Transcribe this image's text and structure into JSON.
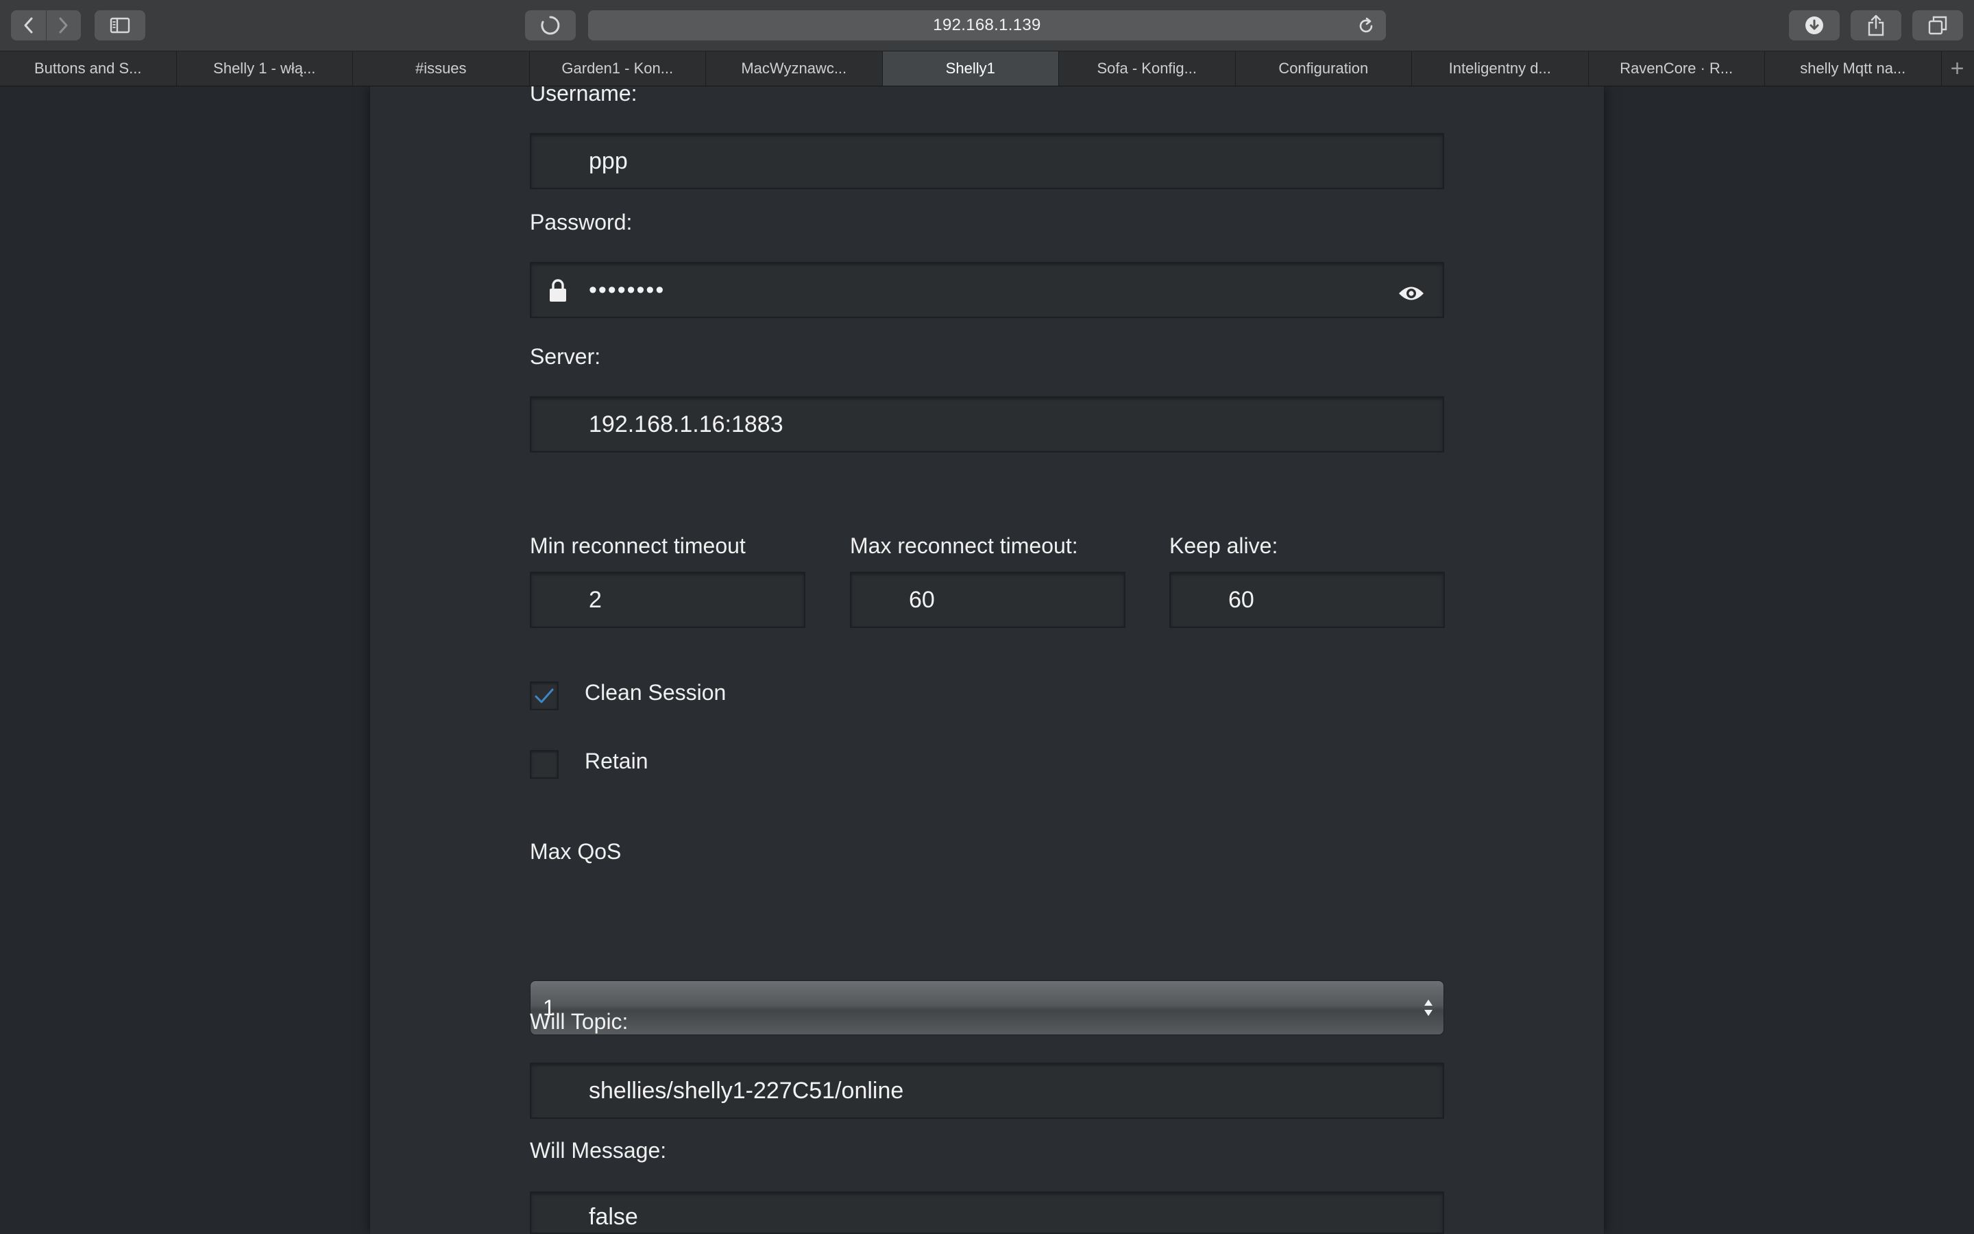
{
  "browser": {
    "url": "192.168.1.139",
    "tabs": [
      {
        "label": "Buttons and S..."
      },
      {
        "label": "Shelly 1 - włą..."
      },
      {
        "label": "#issues"
      },
      {
        "label": "Garden1 - Kon..."
      },
      {
        "label": "MacWyznawc..."
      },
      {
        "label": "Shelly1",
        "active": true
      },
      {
        "label": "Sofa - Konfig..."
      },
      {
        "label": "Configuration"
      },
      {
        "label": "Inteligentny d..."
      },
      {
        "label": "RavenCore · R..."
      },
      {
        "label": "shelly Mqtt na..."
      }
    ],
    "new_tab": "+"
  },
  "form": {
    "username_label": "Username:",
    "username_value": "ppp",
    "password_label": "Password:",
    "password_value": "••••••••",
    "server_label": "Server:",
    "server_value": "192.168.1.16:1883",
    "min_reconnect_label": "Min reconnect timeout",
    "min_reconnect_value": "2",
    "max_reconnect_label": "Max reconnect timeout:",
    "max_reconnect_value": "60",
    "keep_alive_label": "Keep alive:",
    "keep_alive_value": "60",
    "clean_session_label": "Clean Session",
    "clean_session_checked": true,
    "retain_label": "Retain",
    "retain_checked": false,
    "max_qos_label": "Max QoS",
    "max_qos_value": "1",
    "will_topic_label": "Will Topic:",
    "will_topic_value": "shellies/shelly1-227C51/online",
    "will_message_label": "Will Message:",
    "will_message_value": "false"
  },
  "colors": {
    "page_bg": "#25292d",
    "panel_bg": "#2a2e32",
    "checkmark": "#3f86c8"
  }
}
